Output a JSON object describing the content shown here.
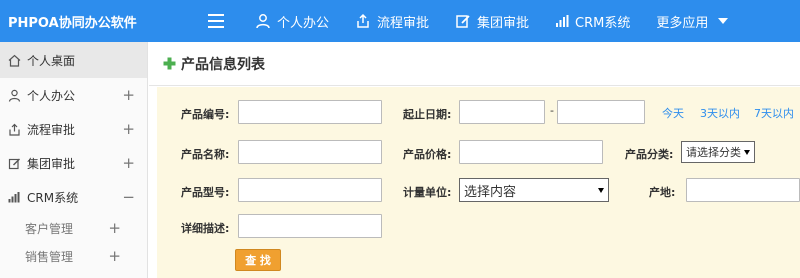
{
  "app": {
    "brand": "PHPOA协同办公软件"
  },
  "topnav": {
    "items": [
      {
        "label": "个人办公",
        "icon": "person-icon"
      },
      {
        "label": "流程审批",
        "icon": "workflow-icon"
      },
      {
        "label": "集团审批",
        "icon": "edit-icon"
      },
      {
        "label": "CRM系统",
        "icon": "bar-chart-icon"
      }
    ],
    "more_label": "更多应用"
  },
  "sidebar": {
    "items": [
      {
        "label": "个人桌面",
        "icon": "home-icon",
        "active": true
      },
      {
        "label": "个人办公",
        "icon": "person-icon",
        "toggle": "+"
      },
      {
        "label": "流程审批",
        "icon": "workflow-icon",
        "toggle": "+"
      },
      {
        "label": "集团审批",
        "icon": "edit-icon",
        "toggle": "+"
      },
      {
        "label": "CRM系统",
        "icon": "bar-chart-icon",
        "toggle": "−"
      }
    ],
    "subitems": [
      {
        "label": "客户管理",
        "toggle": "+"
      },
      {
        "label": "销售管理",
        "toggle": "+"
      }
    ]
  },
  "page": {
    "title": "产品信息列表",
    "title_icon": "plus-icon"
  },
  "form": {
    "product_code_label": "产品编号:",
    "date_range_label": "起止日期:",
    "date_separator": "-",
    "quick_links": [
      "今天",
      "3天以内",
      "7天以内"
    ],
    "product_name_label": "产品名称:",
    "price_label": "产品价格:",
    "category_label": "产品分类:",
    "category_selected": "请选择分类",
    "model_label": "产品型号:",
    "unit_label": "计量单位:",
    "unit_selected": "选择内容",
    "origin_label": "产地:",
    "description_label": "详细描述:",
    "search_button": "查 找"
  },
  "colors": {
    "topbar": "#2d8ded",
    "form_background": "#fdf8e1",
    "button": "#f0a030",
    "link": "#2d8ded",
    "plus_icon": "#4caf50"
  }
}
